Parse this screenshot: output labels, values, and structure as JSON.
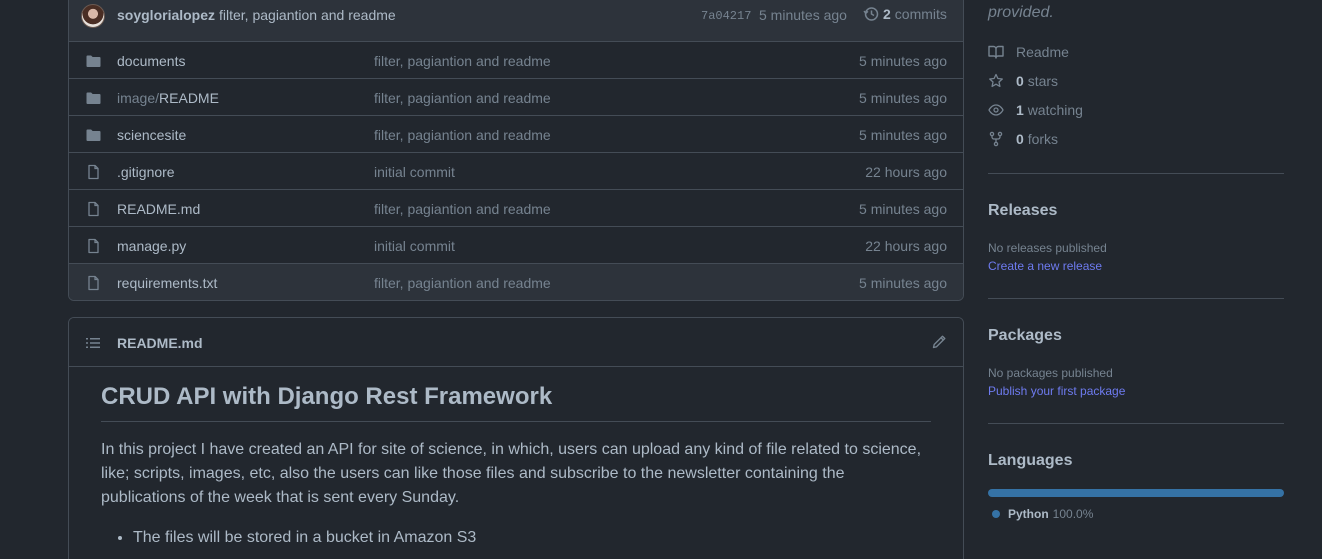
{
  "colors": {
    "bg": "#22272e",
    "header_bg": "#2d333b",
    "border": "#444c56",
    "text": "#adbac7",
    "muted": "#768390",
    "link": "#6e7bf0",
    "python": "#3572A5"
  },
  "commit": {
    "author": "soyglorialopez",
    "message": "filter, pagiantion and readme",
    "sha": "7a04217",
    "time": "5 minutes ago",
    "count": "2",
    "count_label": "commits"
  },
  "files": [
    {
      "type": "folder",
      "name": "documents",
      "message": "filter, pagiantion and readme",
      "time": "5 minutes ago"
    },
    {
      "type": "folder",
      "name_prefix": "image/",
      "name": "README",
      "message": "filter, pagiantion and readme",
      "time": "5 minutes ago"
    },
    {
      "type": "folder",
      "name": "sciencesite",
      "message": "filter, pagiantion and readme",
      "time": "5 minutes ago"
    },
    {
      "type": "file",
      "name": ".gitignore",
      "message": "initial commit",
      "time": "22 hours ago"
    },
    {
      "type": "file",
      "name": "README.md",
      "message": "filter, pagiantion and readme",
      "time": "5 minutes ago"
    },
    {
      "type": "file",
      "name": "manage.py",
      "message": "initial commit",
      "time": "22 hours ago"
    },
    {
      "type": "file",
      "name": "requirements.txt",
      "message": "filter, pagiantion and readme",
      "time": "5 minutes ago"
    }
  ],
  "readme": {
    "file_title": "README.md",
    "heading": "CRUD API with Django Rest Framework",
    "paragraph": "In this project I have created an API for site of science, in which, users can upload any kind of file related to science, like; scripts, images, etc, also the users can like those files and subscribe to the newsletter containing the publications of the week that is sent every Sunday.",
    "bullets": [
      "The files will be stored in a bucket in Amazon S3"
    ]
  },
  "about": {
    "description": "provided.",
    "readme_label": "Readme",
    "stars_count": "0",
    "stars_label": "stars",
    "watching_count": "1",
    "watching_label": "watching",
    "forks_count": "0",
    "forks_label": "forks"
  },
  "releases": {
    "title": "Releases",
    "empty": "No releases published",
    "link": "Create a new release"
  },
  "packages": {
    "title": "Packages",
    "empty": "No packages published",
    "link": "Publish your first package"
  },
  "languages": {
    "title": "Languages",
    "items": [
      {
        "name": "Python",
        "percent": "100.0%",
        "fraction": 1.0
      }
    ]
  }
}
